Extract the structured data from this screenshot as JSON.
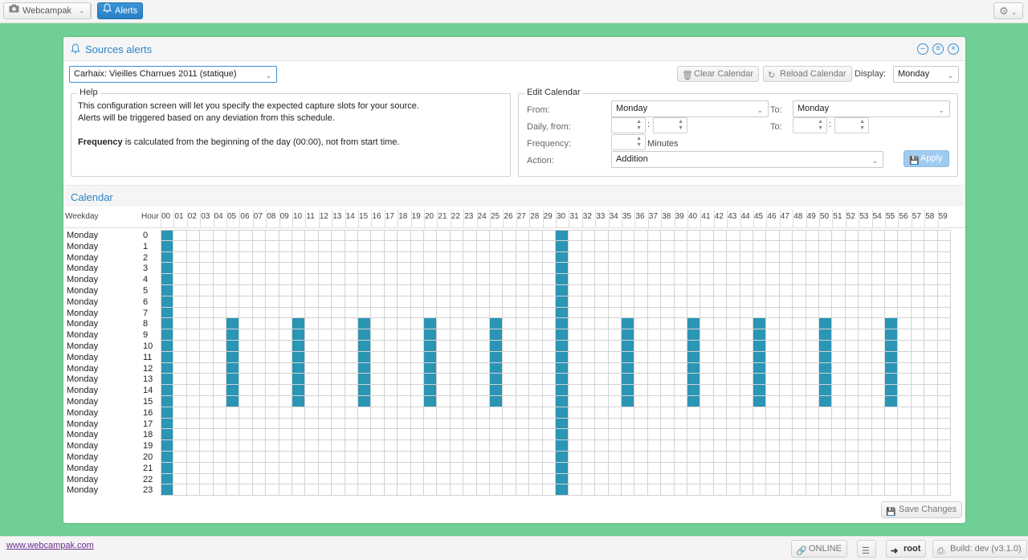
{
  "topbar": {
    "app_button_label": "Webcampak",
    "alerts_button_label": "Alerts",
    "settings_icon": "gear-icon"
  },
  "panel": {
    "title": "Sources alerts",
    "source_select_value": "Carhaix: Vieilles Charrues 2011 (statique)",
    "clear_label": "Clear Calendar",
    "reload_label": "Reload Calendar",
    "display_label": "Display:",
    "display_value": "Monday",
    "help": {
      "legend": "Help",
      "line1": "This configuration screen will let you specify the expected capture slots for your source.",
      "line2": "Alerts will be triggered based on any deviation from this schedule.",
      "line3_bold": "Frequency",
      "line3_rest": " is calculated from the beginning of the day (00:00), not from start time."
    },
    "edit": {
      "legend": "Edit Calendar",
      "from_label": "From:",
      "from_value": "Monday",
      "to_label": "To:",
      "to_value": "Monday",
      "daily_from_label": "Daily, from:",
      "daily_to_label": "To:",
      "colon": ":",
      "frequency_label": "Frequency:",
      "minutes_label": "Minutes",
      "action_label": "Action:",
      "action_value": "Addition",
      "apply_label": "Apply"
    },
    "calendar": {
      "title": "Calendar",
      "weekday_header": "Weekday",
      "hour_header": "Hour",
      "minutes": [
        "00",
        "01",
        "02",
        "03",
        "04",
        "05",
        "06",
        "07",
        "08",
        "09",
        "10",
        "11",
        "12",
        "13",
        "14",
        "15",
        "16",
        "17",
        "18",
        "19",
        "20",
        "21",
        "22",
        "23",
        "24",
        "25",
        "26",
        "27",
        "28",
        "29",
        "30",
        "31",
        "32",
        "33",
        "34",
        "35",
        "36",
        "37",
        "38",
        "39",
        "40",
        "41",
        "42",
        "43",
        "44",
        "45",
        "46",
        "47",
        "48",
        "49",
        "50",
        "51",
        "52",
        "53",
        "54",
        "55",
        "56",
        "57",
        "58",
        "59"
      ],
      "rows": [
        {
          "weekday": "Monday",
          "hour": "0",
          "on": [
            0,
            30
          ]
        },
        {
          "weekday": "Monday",
          "hour": "1",
          "on": [
            0,
            30
          ]
        },
        {
          "weekday": "Monday",
          "hour": "2",
          "on": [
            0,
            30
          ]
        },
        {
          "weekday": "Monday",
          "hour": "3",
          "on": [
            0,
            30
          ]
        },
        {
          "weekday": "Monday",
          "hour": "4",
          "on": [
            0,
            30
          ]
        },
        {
          "weekday": "Monday",
          "hour": "5",
          "on": [
            0,
            30
          ]
        },
        {
          "weekday": "Monday",
          "hour": "6",
          "on": [
            0,
            30
          ]
        },
        {
          "weekday": "Monday",
          "hour": "7",
          "on": [
            0,
            30
          ]
        },
        {
          "weekday": "Monday",
          "hour": "8",
          "on": [
            0,
            5,
            10,
            15,
            20,
            25,
            30,
            35,
            40,
            45,
            50,
            55
          ]
        },
        {
          "weekday": "Monday",
          "hour": "9",
          "on": [
            0,
            5,
            10,
            15,
            20,
            25,
            30,
            35,
            40,
            45,
            50,
            55
          ]
        },
        {
          "weekday": "Monday",
          "hour": "10",
          "on": [
            0,
            5,
            10,
            15,
            20,
            25,
            30,
            35,
            40,
            45,
            50,
            55
          ]
        },
        {
          "weekday": "Monday",
          "hour": "11",
          "on": [
            0,
            5,
            10,
            15,
            20,
            25,
            30,
            35,
            40,
            45,
            50,
            55
          ]
        },
        {
          "weekday": "Monday",
          "hour": "12",
          "on": [
            0,
            5,
            10,
            15,
            20,
            25,
            30,
            35,
            40,
            45,
            50,
            55
          ]
        },
        {
          "weekday": "Monday",
          "hour": "13",
          "on": [
            0,
            5,
            10,
            15,
            20,
            25,
            30,
            35,
            40,
            45,
            50,
            55
          ]
        },
        {
          "weekday": "Monday",
          "hour": "14",
          "on": [
            0,
            5,
            10,
            15,
            20,
            25,
            30,
            35,
            40,
            45,
            50,
            55
          ]
        },
        {
          "weekday": "Monday",
          "hour": "15",
          "on": [
            0,
            5,
            10,
            15,
            20,
            25,
            30,
            35,
            40,
            45,
            50,
            55
          ]
        },
        {
          "weekday": "Monday",
          "hour": "16",
          "on": [
            0,
            30
          ]
        },
        {
          "weekday": "Monday",
          "hour": "17",
          "on": [
            0,
            30
          ]
        },
        {
          "weekday": "Monday",
          "hour": "18",
          "on": [
            0,
            30
          ]
        },
        {
          "weekday": "Monday",
          "hour": "19",
          "on": [
            0,
            30
          ]
        },
        {
          "weekday": "Monday",
          "hour": "20",
          "on": [
            0,
            30
          ]
        },
        {
          "weekday": "Monday",
          "hour": "21",
          "on": [
            0,
            30
          ]
        },
        {
          "weekday": "Monday",
          "hour": "22",
          "on": [
            0,
            30
          ]
        },
        {
          "weekday": "Monday",
          "hour": "23",
          "on": [
            0,
            30
          ]
        }
      ],
      "active_color": "#2b95b4"
    },
    "save_label": "Save Changes"
  },
  "footer": {
    "site_link": "www.webcampak.com",
    "online_label": "ONLINE",
    "user_label": "root",
    "build_label": "Build: dev (v3.1.0)"
  }
}
